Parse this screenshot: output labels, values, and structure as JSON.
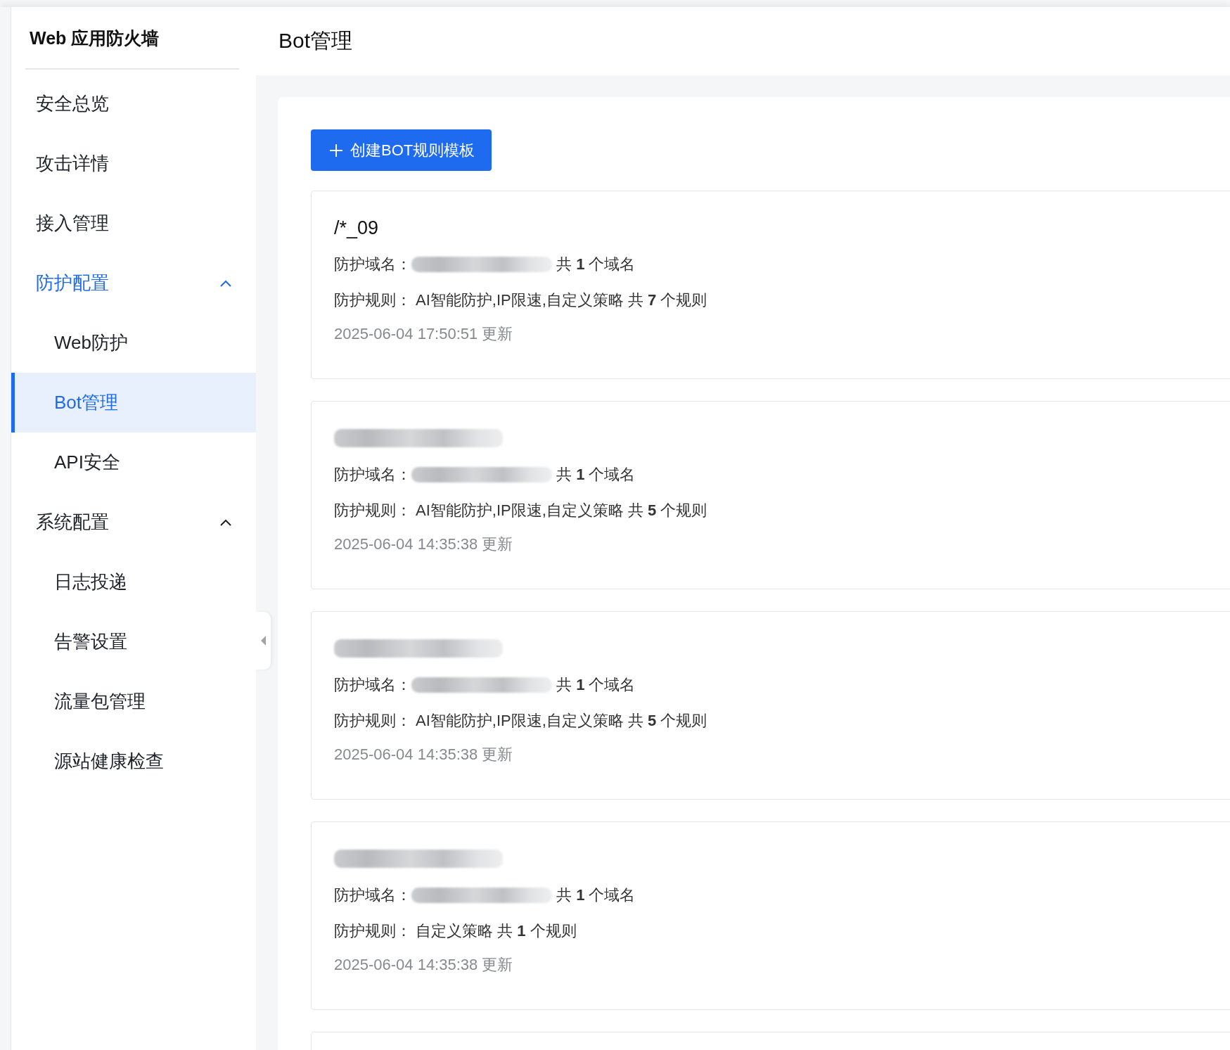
{
  "sidebar": {
    "title": "Web 应用防火墙",
    "items": [
      {
        "label": "安全总览",
        "selected": false
      },
      {
        "label": "攻击详情",
        "selected": false
      },
      {
        "label": "接入管理",
        "selected": false
      },
      {
        "label": "防护配置",
        "selected": true,
        "expanded": true,
        "children": [
          {
            "label": "Web防护",
            "selected": false
          },
          {
            "label": "Bot管理",
            "selected": true
          },
          {
            "label": "API安全",
            "selected": false
          }
        ]
      },
      {
        "label": "系统配置",
        "selected": false,
        "expanded": true,
        "children": [
          {
            "label": "日志投递",
            "selected": false
          },
          {
            "label": "告警设置",
            "selected": false
          },
          {
            "label": "流量包管理",
            "selected": false
          },
          {
            "label": "源站健康检查",
            "selected": false
          }
        ]
      }
    ]
  },
  "page": {
    "title": "Bot管理"
  },
  "create_button": {
    "label": "创建BOT规则模板"
  },
  "cards": [
    {
      "title": "/*_09",
      "domain_label": "防护域名：",
      "domain_redacted": true,
      "domain_count": "共 **1** 个域名",
      "rules_label": "防护规则：",
      "rules": "AI智能防护,IP限速,自定义策略 共 **7** 个规则",
      "updated": "2025-06-04 17:50:51 更新"
    },
    {
      "title_redacted": true,
      "domain_label": "防护域名：",
      "domain_redacted": true,
      "domain_count": "共 **1** 个域名",
      "rules_label": "防护规则：",
      "rules": "AI智能防护,IP限速,自定义策略 共 **5** 个规则",
      "updated": "2025-06-04 14:35:38 更新"
    },
    {
      "title_redacted": true,
      "domain_label": "防护域名：",
      "domain_redacted": true,
      "domain_count": "共 **1** 个域名",
      "rules_label": "防护规则：",
      "rules": "AI智能防护,IP限速,自定义策略 共 **5** 个规则",
      "updated": "2025-06-04 14:35:38 更新"
    },
    {
      "title_redacted": true,
      "domain_label": "防护域名：",
      "domain_redacted": true,
      "domain_count": "共 **1** 个域名",
      "rules_label": "防护规则：",
      "rules": "自定义策略 共 **1** 个规则",
      "updated": "2025-06-04 14:35:38 更新"
    }
  ]
}
